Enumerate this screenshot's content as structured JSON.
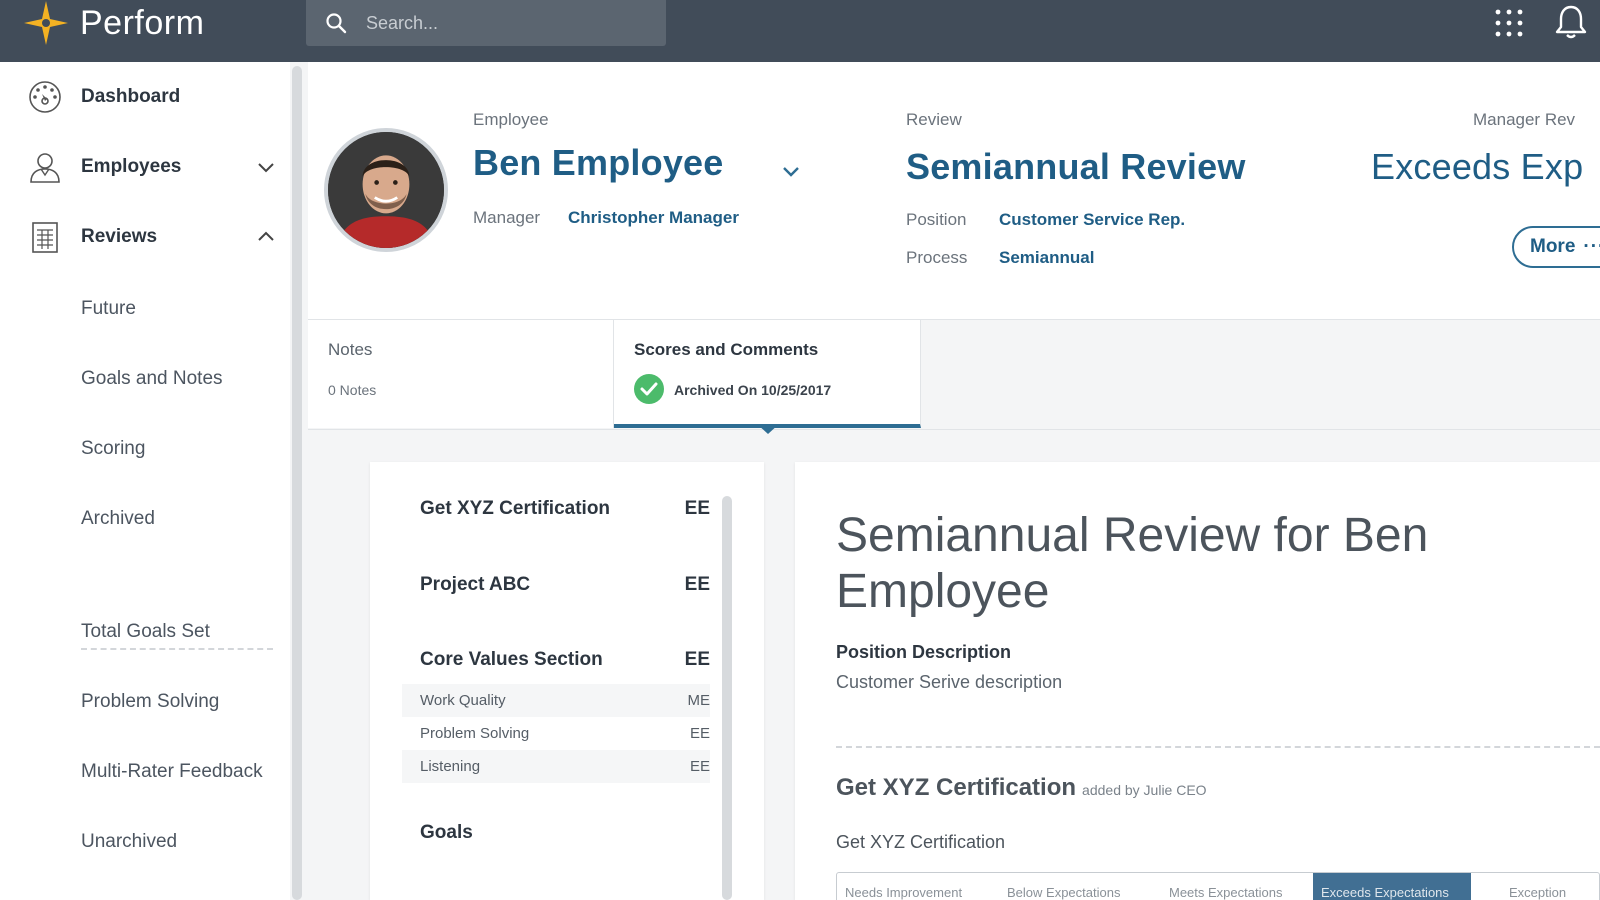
{
  "app": {
    "name": "Perform"
  },
  "search": {
    "placeholder": "Search..."
  },
  "sidebar": {
    "items": [
      {
        "label": "Dashboard"
      },
      {
        "label": "Employees"
      },
      {
        "label": "Reviews"
      }
    ],
    "review_sub": [
      "Future",
      "Goals and Notes",
      "Scoring",
      "Archived"
    ],
    "extra_sub": [
      "Total Goals Set",
      "Problem Solving",
      "Multi-Rater Feedback",
      "Unarchived"
    ]
  },
  "header": {
    "employee_label": "Employee",
    "employee_name": "Ben Employee",
    "manager_label": "Manager",
    "manager_name": "Christopher Manager",
    "review_label": "Review",
    "review_name": "Semiannual Review",
    "position_label": "Position",
    "position_value": "Customer Service Rep.",
    "process_label": "Process",
    "process_value": "Semiannual",
    "manager_review_label": "Manager Rev",
    "manager_review_value": "Exceeds Exp",
    "more_label": "More",
    "more_dots": "···"
  },
  "tabs": {
    "notes_title": "Notes",
    "notes_count": "0 Notes",
    "scores_title": "Scores and Comments",
    "archived_text": "Archived On 10/25/2017"
  },
  "goals_list": {
    "rows": [
      {
        "title": "Get XYZ Certification",
        "score": "EE"
      },
      {
        "title": "Project ABC",
        "score": "EE"
      },
      {
        "title": "Core Values Section",
        "score": "EE"
      }
    ],
    "subrows": [
      {
        "title": "Work Quality",
        "score": "ME"
      },
      {
        "title": "Problem Solving",
        "score": "EE"
      },
      {
        "title": "Listening",
        "score": "EE"
      }
    ],
    "goals_heading": "Goals"
  },
  "detail": {
    "title": "Semiannual Review for Ben Employee",
    "position_heading": "Position Description",
    "position_desc": "Customer Serive description",
    "goal_title": "Get XYZ Certification",
    "goal_added_by": "added by Julie CEO",
    "goal_desc": "Get XYZ Certification",
    "rating_options": [
      "Needs Improvement",
      "Below Expectations",
      "Meets Expectations",
      "Exceeds Expectations",
      "Exception"
    ],
    "rating_selected": 3
  },
  "colors": {
    "topbar": "#414c59",
    "accent": "#1f5d85",
    "success": "#4cbb6b"
  }
}
